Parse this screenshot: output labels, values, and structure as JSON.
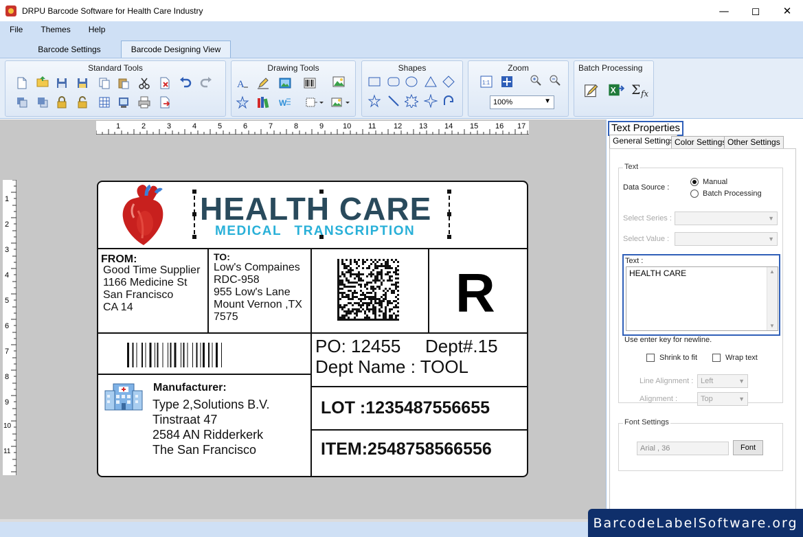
{
  "window": {
    "title": "DRPU Barcode Software for Health Care Industry",
    "controls": [
      "minimize-icon",
      "maximize-icon",
      "close-icon"
    ]
  },
  "menu": {
    "items": [
      "File",
      "Themes",
      "Help"
    ]
  },
  "tabs": [
    {
      "label": "Barcode Settings",
      "active": false
    },
    {
      "label": "Barcode Designing View",
      "active": true
    }
  ],
  "ribbon": {
    "groups": [
      {
        "title": "Standard Tools"
      },
      {
        "title": "Drawing Tools"
      },
      {
        "title": "Shapes"
      },
      {
        "title": "Zoom",
        "zoom_value": "100%"
      },
      {
        "title": "Batch Processing"
      }
    ]
  },
  "rulers": {
    "top": [
      "1",
      "2",
      "3",
      "4",
      "5",
      "6",
      "7",
      "8",
      "9",
      "10",
      "11",
      "12",
      "13",
      "14",
      "15",
      "16",
      "17"
    ],
    "left": [
      "1",
      "2",
      "3",
      "4",
      "5",
      "6",
      "7",
      "8",
      "9",
      "10",
      "11"
    ]
  },
  "label": {
    "title": "HEALTH CARE",
    "subtitle": "MEDICAL   TRANSCRIPTION",
    "from_heading": "FROM:",
    "from_lines": [
      "Good Time Supplier",
      "1166 Medicine St",
      "San Francisco",
      "CA 14"
    ],
    "to_heading": "TO:",
    "to_lines": [
      "Low's Compaines",
      "RDC-958",
      "955 Low's Lane",
      "Mount Vernon ,TX",
      "7575"
    ],
    "big_letter": "R",
    "po": "PO: 12455",
    "dept": "Dept#.15",
    "dept_name": "Dept Name : TOOL",
    "mfr_heading": "Manufacturer:",
    "mfr_lines": [
      "Type 2,Solutions B.V.",
      "Tinstraat 47",
      "2584 AN Ridderkerk",
      "The San Francisco"
    ],
    "lot": "LOT :1235487556655",
    "item": "ITEM:2548758566556",
    "colors": {
      "title": "#294a5c",
      "subtitle": "#29b0d8"
    }
  },
  "properties": {
    "title": "Text Properties",
    "tabs": [
      {
        "label": "General Settings",
        "active": true
      },
      {
        "label": "Color Settings",
        "active": false
      },
      {
        "label": "Other Settings",
        "active": false
      }
    ],
    "text_group": "Text",
    "data_source_label": "Data Source :",
    "data_source_options": [
      "Manual",
      "Batch Processing"
    ],
    "data_source_selected": "Manual",
    "select_series_label": "Select Series :",
    "select_value_label": "Select Value :",
    "text_label": "Text :",
    "text_value": "HEALTH CARE",
    "hint": "Use enter key for newline.",
    "shrink_label": "Shrink to fit",
    "wrap_label": "Wrap text",
    "line_alignment_label": "Line Alignment :",
    "line_alignment_value": "Left",
    "alignment_label": "Alignment :",
    "alignment_value": "Top",
    "font_group": "Font Settings",
    "font_value": "Arial , 36",
    "font_button": "Font"
  },
  "watermark": "BarcodeLabelSoftware.org"
}
